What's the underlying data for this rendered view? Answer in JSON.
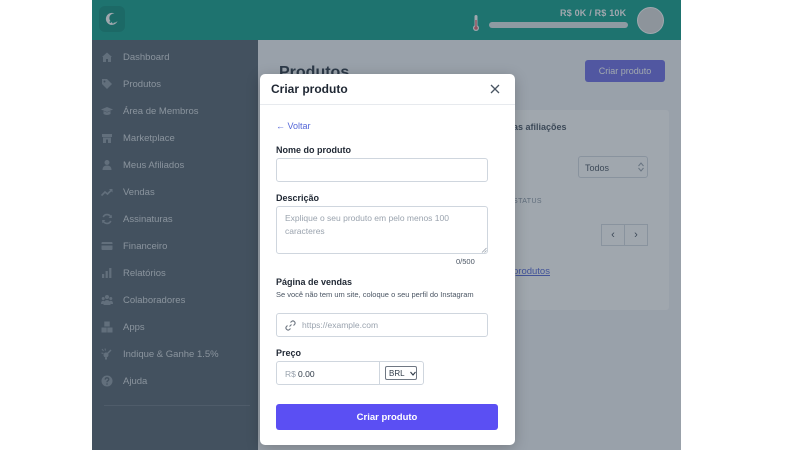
{
  "header": {
    "revenue_label": "R$ 0K / R$ 10K",
    "revenue_progress": 0,
    "logo_icon": "logo-icon",
    "thermometer_icon": "thermometer-icon"
  },
  "sidebar": {
    "items": [
      {
        "label": "Dashboard",
        "icon": "home-icon"
      },
      {
        "label": "Produtos",
        "icon": "tag-icon"
      },
      {
        "label": "Área de Membros",
        "icon": "graduation-cap-icon"
      },
      {
        "label": "Marketplace",
        "icon": "store-icon"
      },
      {
        "label": "Meus Afiliados",
        "icon": "user-icon"
      },
      {
        "label": "Vendas",
        "icon": "trend-icon"
      },
      {
        "label": "Assinaturas",
        "icon": "refresh-icon"
      },
      {
        "label": "Financeiro",
        "icon": "credit-card-icon"
      },
      {
        "label": "Relatórios",
        "icon": "bar-chart-icon"
      },
      {
        "label": "Colaboradores",
        "icon": "users-icon"
      },
      {
        "label": "Apps",
        "icon": "cubes-icon"
      },
      {
        "label": "Indique & Ganhe 1.5%",
        "icon": "megaphone-icon"
      },
      {
        "label": "Ajuda",
        "icon": "help-icon"
      }
    ]
  },
  "page": {
    "title": "Produtos",
    "create_button": "Criar produto",
    "tab_label": "as afiliações",
    "filter_value": "Todos",
    "status_label": "STATUS",
    "empty_link": "produtos"
  },
  "modal": {
    "title": "Criar produto",
    "back_label": "← Voltar",
    "name_label": "Nome do produto",
    "name_value": "",
    "name_placeholder": "",
    "description_label": "Descrição",
    "description_placeholder": "Explique o seu produto em pelo menos 100 caracteres",
    "description_counter": "0/500",
    "sales_page_label": "Página de vendas",
    "sales_page_hint": "Se você não tem um site, coloque o seu perfil do Instagram",
    "sales_page_placeholder": "https://example.com",
    "price_label": "Preço",
    "price_prefix": "R$",
    "price_value": "0.00",
    "currency": "BRL",
    "submit_label": "Criar produto"
  },
  "colors": {
    "topbar": "#13a08c",
    "sidebar": "#57636f",
    "accent": "#5b4ff3",
    "link": "#5466d8"
  }
}
